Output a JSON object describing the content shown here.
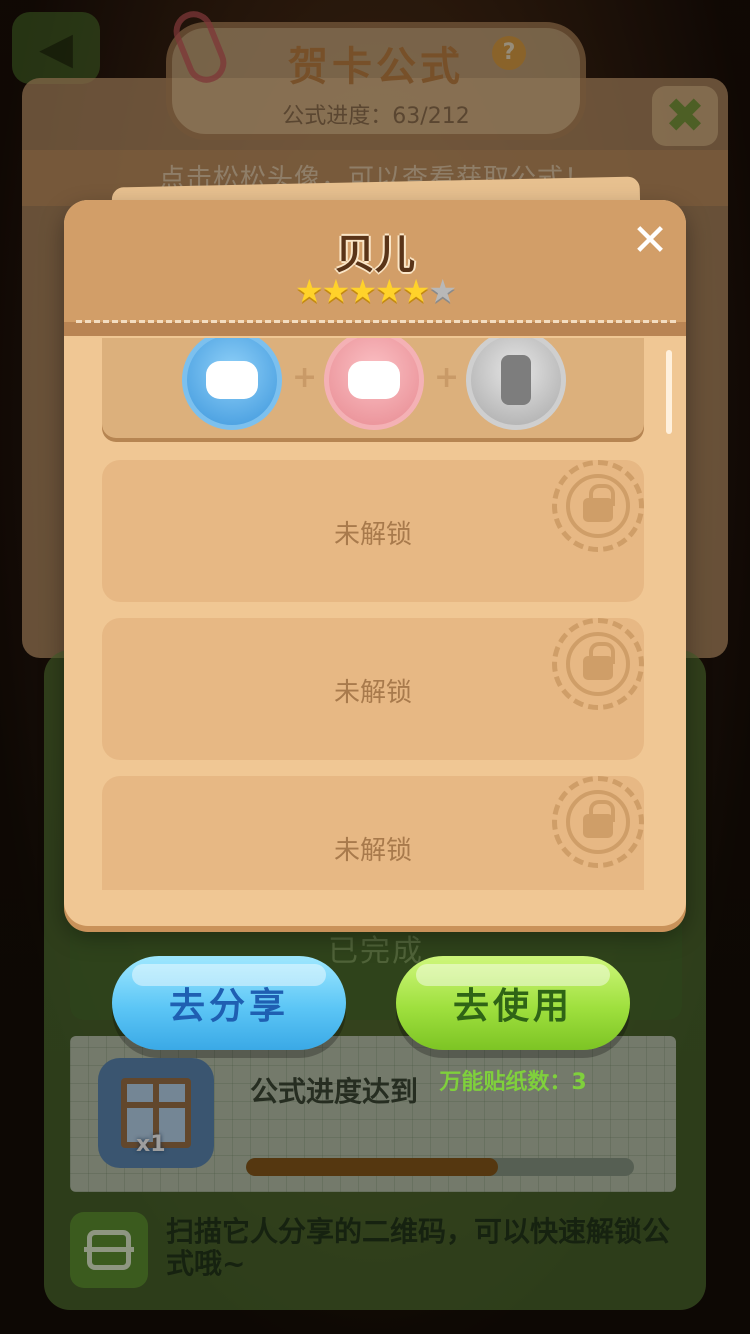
{
  "formula_panel": {
    "title": "贺卡公式",
    "progress_text": "公式进度：63/212",
    "hint": "点击松松头像，可以查看获取公式！",
    "help_icon": "question-icon",
    "close_icon": "close-x-icon"
  },
  "modal": {
    "character_name": "贝儿",
    "rating": {
      "filled": 5,
      "total": 6
    },
    "close_icon": "close-icon",
    "formula": {
      "ingredients": [
        {
          "name": "goggles-icon",
          "color": "#3c96dc"
        },
        {
          "name": "blush-face-icon",
          "color": "#e78a91"
        },
        {
          "name": "comb-icon",
          "color": "#a8a8a8"
        }
      ],
      "operator": "+"
    },
    "locked_slots": [
      {
        "label": "未解锁"
      },
      {
        "label": "未解锁"
      },
      {
        "label": "未解锁"
      }
    ]
  },
  "reward": {
    "status": "已完成",
    "text": "公式进度达到",
    "item_count": "x1",
    "progress": 0.65
  },
  "actions": {
    "share_label": "去分享",
    "use_label": "去使用",
    "sticker_count": "万能贴纸数：3"
  },
  "scan_hint": "扫描它人分享的二维码，可以快速解锁公式哦~",
  "colors": {
    "modal_bg": "#f0c794",
    "header_bg": "#d29e68",
    "share_button": "#5cc6f6",
    "use_button": "#9fe03e",
    "star_on": "#ffd22a",
    "star_off": "#b8b8b8"
  }
}
